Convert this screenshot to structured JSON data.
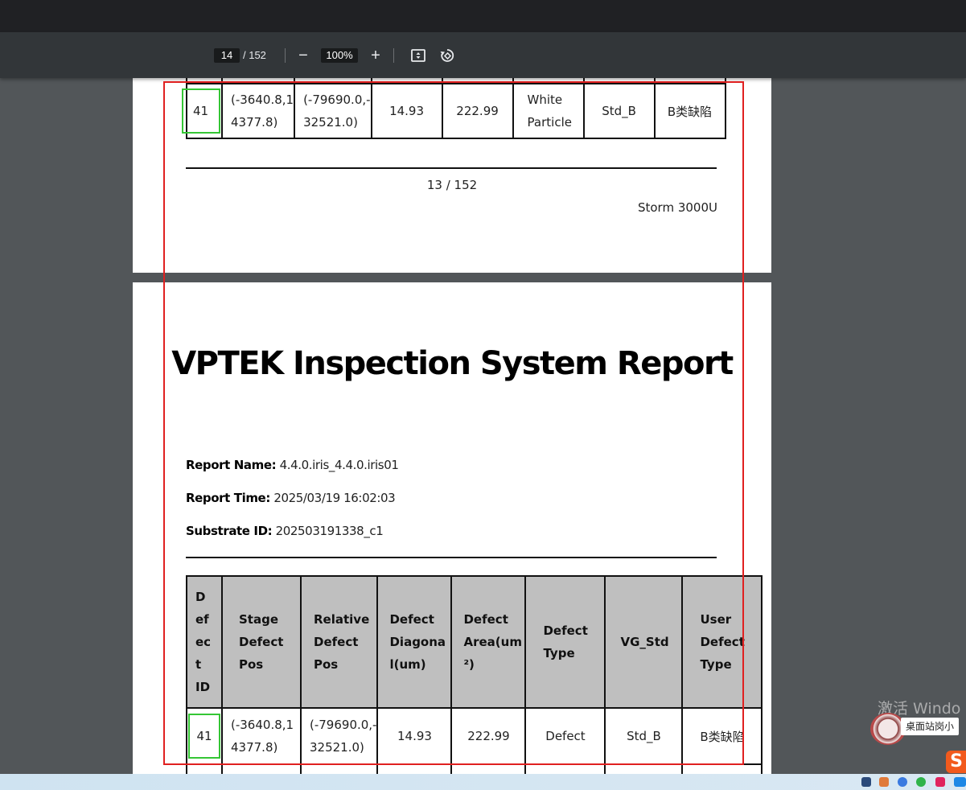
{
  "toolbar": {
    "current_page": "14",
    "total_pages": "/ 152",
    "zoom": "100%",
    "zoom_out_glyph": "−",
    "zoom_in_glyph": "+",
    "fit_icon": "fit-to-page-icon",
    "rotate_icon": "rotate-icon"
  },
  "page13": {
    "row": {
      "id": "41",
      "stage_pos": [
        "(-3640.8,1",
        "4377.8)"
      ],
      "relative_pos": [
        "(-79690.0,-",
        "32521.0)"
      ],
      "diagonal": "14.93",
      "area": "222.99",
      "type": [
        "White",
        "Particle"
      ],
      "vg_std": "Std_B",
      "user_type": "B类缺陷"
    },
    "page_number": "13 / 152",
    "model": "Storm 3000U"
  },
  "page14": {
    "title": "VPTEK Inspection System Report",
    "report_name_label": "Report Name:",
    "report_name": "4.4.0.iris_4.4.0.iris01",
    "report_time_label": "Report Time:",
    "report_time": "2025/03/19 16:02:03",
    "substrate_label": "Substrate ID:",
    "substrate_id": "202503191338_c1",
    "headers": {
      "id": [
        "D",
        "ef",
        "ec",
        "t",
        "ID"
      ],
      "stage": [
        "Stage",
        "Defect",
        "Pos"
      ],
      "relative": [
        "Relative",
        "Defect",
        "Pos"
      ],
      "diagonal": [
        "Defect",
        "Diagona",
        "l(um)"
      ],
      "area": [
        "Defect",
        "Area(um",
        "²)"
      ],
      "type": [
        "Defect",
        "Type"
      ],
      "vg": [
        "VG_Std"
      ],
      "user": [
        "User",
        "Defect",
        "Type"
      ]
    },
    "row": {
      "id": "41",
      "stage_pos": [
        "(-3640.8,1",
        "4377.8)"
      ],
      "relative_pos": [
        "(-79690.0,-",
        "32521.0)"
      ],
      "diagonal": "14.93",
      "area": "222.99",
      "type": "Defect",
      "vg_std": "Std_B",
      "user_type": "B类缺陷"
    }
  },
  "overlay": {
    "watermark": "激活 Windo",
    "widget_label": "桌面站岗小",
    "sogou_letter": "S"
  },
  "colors": {
    "highlight_rect": "#e02020",
    "id_box": "#35c635",
    "header_bg": "#bfbfbf"
  }
}
